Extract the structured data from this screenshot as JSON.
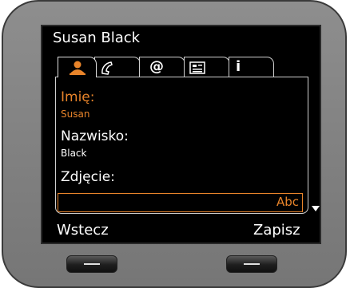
{
  "header": {
    "title": "Susan Black"
  },
  "tabs": [
    {
      "name": "tab-person",
      "icon": "person-icon",
      "active": true
    },
    {
      "name": "tab-phone",
      "icon": "phone-icon",
      "glyph": "✆"
    },
    {
      "name": "tab-email",
      "icon": "at-icon",
      "glyph": "@"
    },
    {
      "name": "tab-card",
      "icon": "card-icon"
    },
    {
      "name": "tab-info",
      "icon": "info-icon",
      "glyph": "i"
    }
  ],
  "form": {
    "first_name_label": "Imię:",
    "first_name_value": "Susan",
    "last_name_label": "Nazwisko:",
    "last_name_value": "Black",
    "photo_label": "Zdjęcie:",
    "input_mode": "Abc"
  },
  "softkeys": {
    "left": "Wstecz",
    "right": "Zapisz"
  },
  "colors": {
    "accent": "#e8842a",
    "screen_bg": "#000000",
    "bezel": "#8a8a8a"
  }
}
